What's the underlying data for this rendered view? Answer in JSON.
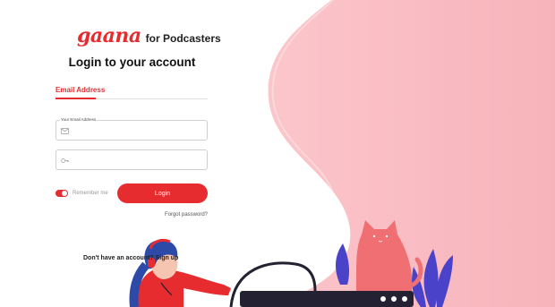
{
  "brand": {
    "logo": "gaana",
    "subtitle": "for Podcasters",
    "accent": "#e72c30"
  },
  "title": "Login to your account",
  "tabs": [
    {
      "label": "Email Address",
      "active": true
    }
  ],
  "email": {
    "label": "Your Email Address",
    "value": "",
    "placeholder": "",
    "icon": "mail-icon"
  },
  "password": {
    "value": "",
    "placeholder": "",
    "icon": "key-icon"
  },
  "remember": {
    "label": "Remember me",
    "checked": true
  },
  "login_button": "Login",
  "forgot_link": "Forgot password?",
  "signup_prompt": "Don't have an account? Sign up",
  "colors": {
    "pink_bg": "#f8b8be",
    "pink_light": "#fbd6d9",
    "cat": "#ef6f73",
    "plant": "#4a43c9",
    "screen": "#232132"
  }
}
